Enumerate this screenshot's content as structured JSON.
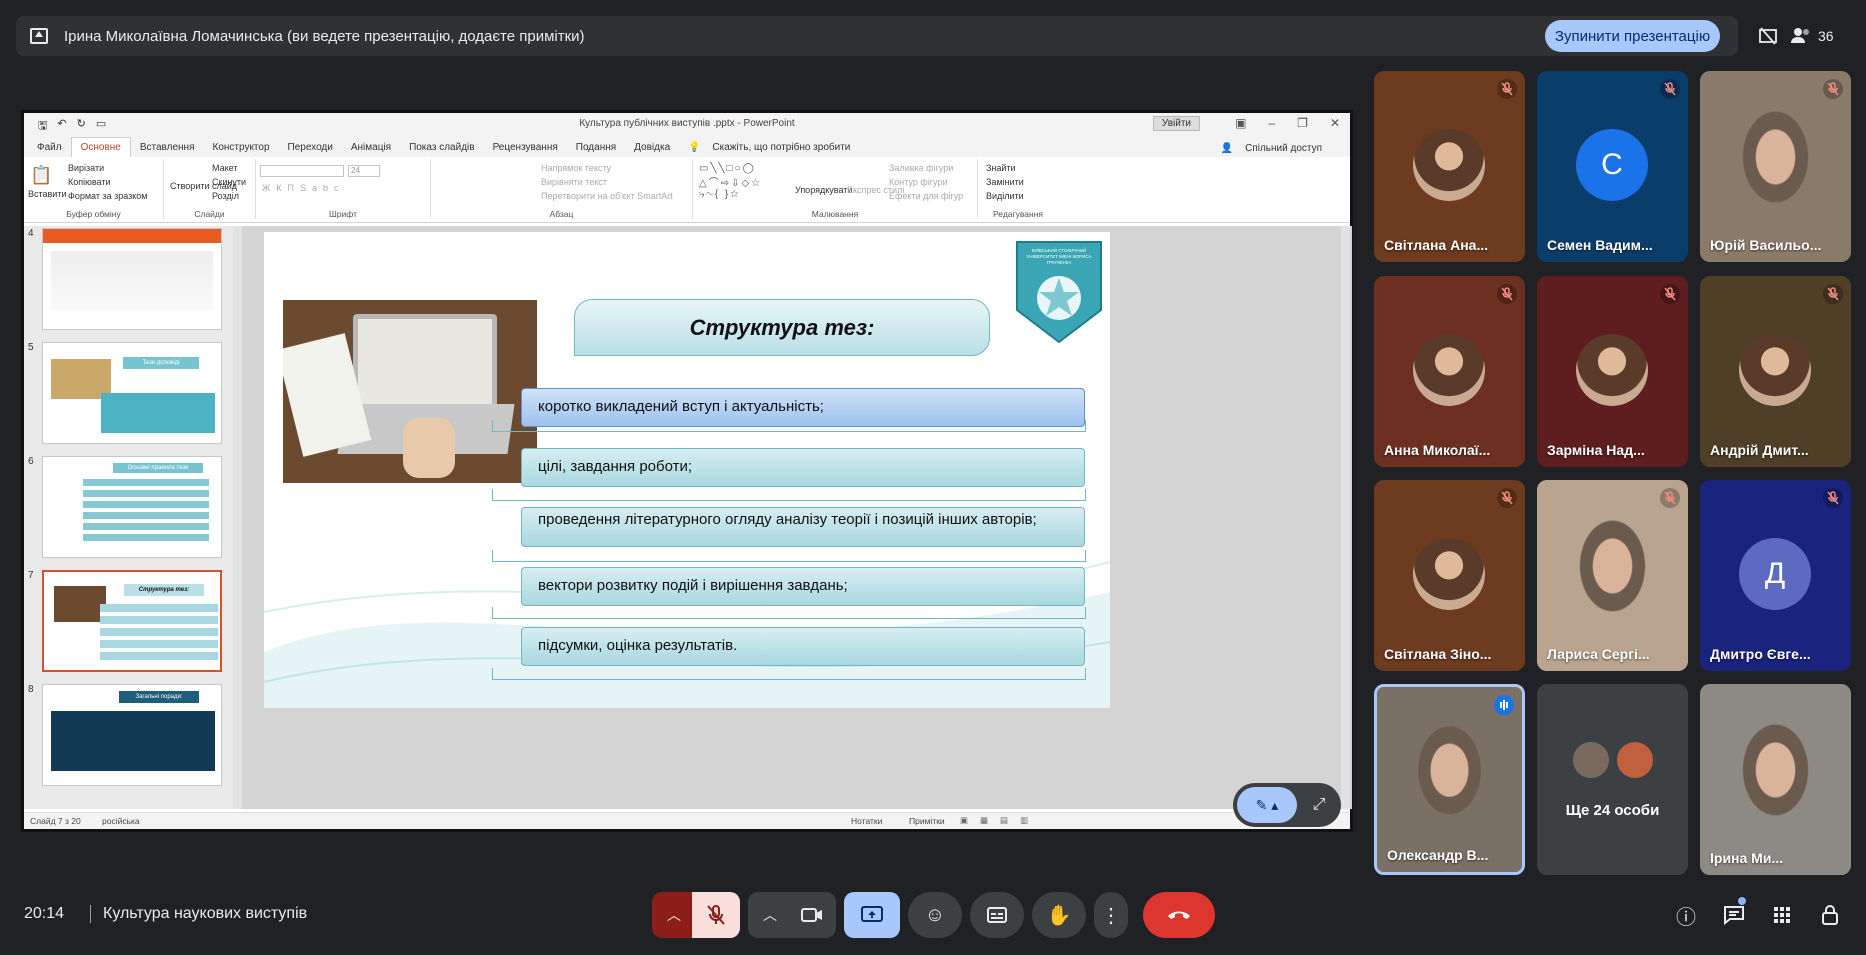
{
  "banner": {
    "text": "Ірина Миколаївна Ломачинська (ви ведете презентацію, додаєте примітки)",
    "stop_label": "Зупинити презентацію",
    "people_count": "36"
  },
  "ppt": {
    "window_title": "Культура публічних виступів .pptx - PowerPoint",
    "signin_label": "Увійти",
    "tabs": [
      "Файл",
      "Основне",
      "Вставлення",
      "Конструктор",
      "Переходи",
      "Анімація",
      "Показ слайдів",
      "Рецензування",
      "Подання",
      "Довідка"
    ],
    "tell_me": "Скажіть, що потрібно зробити",
    "share": "Спільний доступ",
    "ribbon": {
      "paste": "Вставити",
      "cut": "Вирізати",
      "copy": "Копіювати",
      "format_painter": "Формат за зразком",
      "clipboard": "Буфер обміну",
      "new_slide": "Створити слайд",
      "layout": "Макет",
      "reset": "Скинути",
      "section": "Розділ",
      "slides": "Слайди",
      "font_size": "24",
      "font_group": "Шрифт",
      "text_direction": "Напрямок тексту",
      "align_text": "Вирівняти текст",
      "smartart": "Перетворити на об'єкт SmartArt",
      "paragraph": "Абзац",
      "arrange": "Упорядкувати",
      "quick_styles": "Експрес стилі",
      "shape_fill": "Заливка фігури",
      "shape_outline": "Контур фігури",
      "shape_effects": "Ефекти для фігур",
      "drawing": "Малювання",
      "find": "Знайти",
      "replace": "Замінити",
      "select": "Виділити",
      "editing": "Редагування"
    },
    "thumbs": [
      {
        "num": "4",
        "title": ""
      },
      {
        "num": "5",
        "title": "Тези доповіді"
      },
      {
        "num": "6",
        "title": "Основні правила тези"
      },
      {
        "num": "7",
        "title": "Структура тез:"
      },
      {
        "num": "8",
        "title": "Загальні поради:"
      }
    ],
    "slide": {
      "title": "Структура тез:",
      "logo_text": "КИЇВСЬКИЙ СТОЛИЧНИЙ УНІВЕРСИТЕТ ІМЕНІ БОРИСА ГРІНЧЕНКА",
      "bullets": [
        "коротко викладений вступ і актуальність;",
        "цілі, завдання роботи;",
        "проведення літературного огляду аналізу теорії і позицій інших авторів;",
        "вектори розвитку подій і вирішення завдань;",
        "підсумки, оцінка результатів."
      ]
    },
    "status": {
      "slide_of": "Слайд 7 з 20",
      "language": "російська",
      "notes": "Нотатки",
      "comments": "Примітки"
    }
  },
  "participants": [
    {
      "name": "Світлана Ана...",
      "initial": "",
      "bg": "#6d3b1f",
      "muted": true
    },
    {
      "name": "Семен Вадим...",
      "initial": "С",
      "bg": "#0b3d6b",
      "muted": true
    },
    {
      "name": "Юрій Васильо...",
      "initial": "",
      "bg": "#8a7a6a",
      "muted": true
    },
    {
      "name": "Анна Миколаї...",
      "initial": "",
      "bg": "#6d2f1f",
      "muted": true
    },
    {
      "name": "Зарміна Над...",
      "initial": "",
      "bg": "#5e1d1f",
      "muted": true
    },
    {
      "name": "Андрій Дмит...",
      "initial": "",
      "bg": "#4e3f26",
      "muted": true
    },
    {
      "name": "Світлана Зіно...",
      "initial": "",
      "bg": "#6d3b1f",
      "muted": true
    },
    {
      "name": "Лариса Сергі...",
      "initial": "",
      "bg": "#b8a48f",
      "muted": true
    },
    {
      "name": "Дмитро Євге...",
      "initial": "Д",
      "bg": "#1a237e",
      "muted": true
    },
    {
      "name": "Олександр В...",
      "initial": "",
      "bg": "#7a7065",
      "muted": false
    },
    {
      "name": "Ще 24 особи",
      "initial": "",
      "bg": "#3c4043",
      "muted": false
    },
    {
      "name": "Ірина Ми...",
      "initial": "",
      "bg": "#8d8a84",
      "muted": false
    }
  ],
  "footer": {
    "time": "20:14",
    "meeting_title": "Культура наукових виступів"
  },
  "colors": {
    "meet_bg": "#202124",
    "accent_blue": "#a8c7fa",
    "end_call": "#dc362e",
    "mic_off": "#f9dedc"
  }
}
